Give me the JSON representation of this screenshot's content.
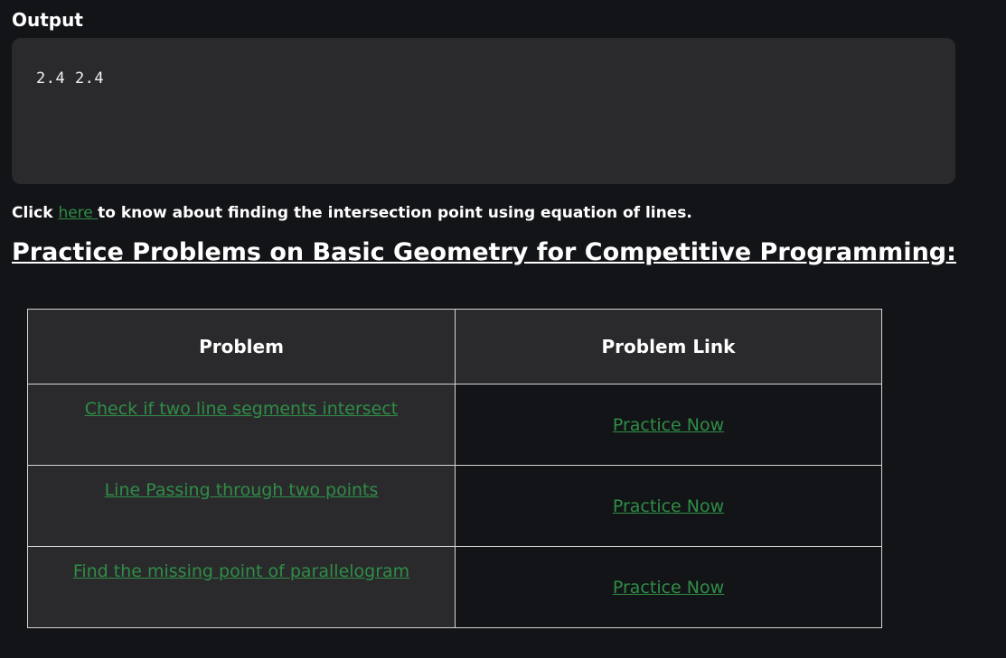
{
  "output": {
    "heading": "Output",
    "text": "2.4 2.4"
  },
  "click_line": {
    "prefix": "Click ",
    "link_text": "here ",
    "suffix": "to know about finding the intersection point using equation of lines."
  },
  "practice": {
    "heading": "Practice Problems on Basic Geometry for Competitive Programming:",
    "table": {
      "headers": [
        "Problem",
        "Problem Link"
      ],
      "rows": [
        {
          "problem": "Check if two line segments intersect",
          "link": "Practice Now"
        },
        {
          "problem": "Line Passing through two points",
          "link": "Practice Now"
        },
        {
          "problem": "Find the missing point of parallelogram",
          "link": "Practice Now"
        }
      ]
    }
  },
  "colors": {
    "background": "#131417",
    "panel": "#2a2a2d",
    "link": "#2f8d46",
    "text": "#ffffff"
  }
}
